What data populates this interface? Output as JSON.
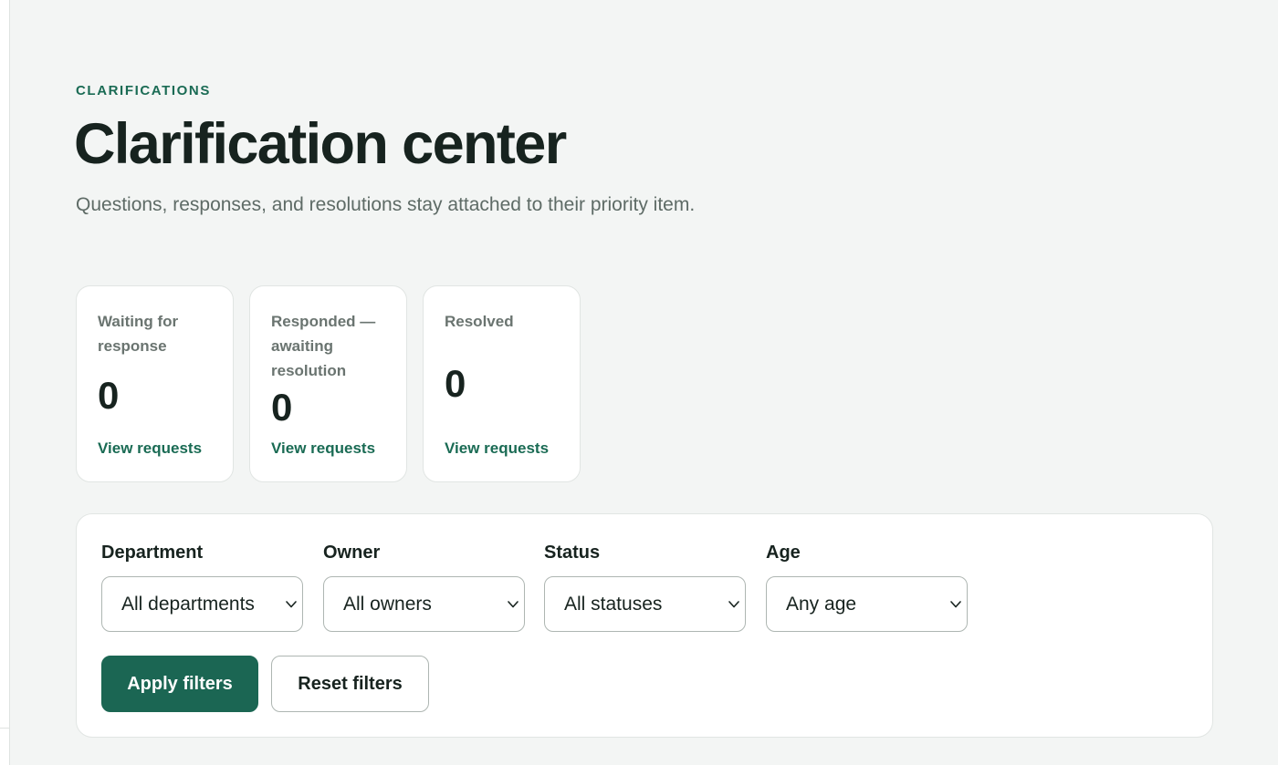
{
  "header": {
    "eyebrow": "CLARIFICATIONS",
    "title": "Clarification center",
    "subtitle": "Questions, responses, and resolutions stay attached to their priority item."
  },
  "stats": [
    {
      "label": "Waiting for response",
      "value": "0",
      "link": "View requests"
    },
    {
      "label": "Responded — awaiting resolution",
      "value": "0",
      "link": "View requests"
    },
    {
      "label": "Resolved",
      "value": "0",
      "link": "View requests"
    }
  ],
  "filters": {
    "department": {
      "label": "Department",
      "value": "All departments"
    },
    "owner": {
      "label": "Owner",
      "value": "All owners"
    },
    "status": {
      "label": "Status",
      "value": "All statuses"
    },
    "age": {
      "label": "Age",
      "value": "Any age"
    },
    "apply_label": "Apply filters",
    "reset_label": "Reset filters"
  },
  "colors": {
    "accent": "#1a6b54",
    "primary_button": "#1b6653",
    "page_background": "#f3f5f4",
    "muted_text": "#5e6b66"
  },
  "icons": {
    "select_indicator": "chevron-down-icon"
  }
}
